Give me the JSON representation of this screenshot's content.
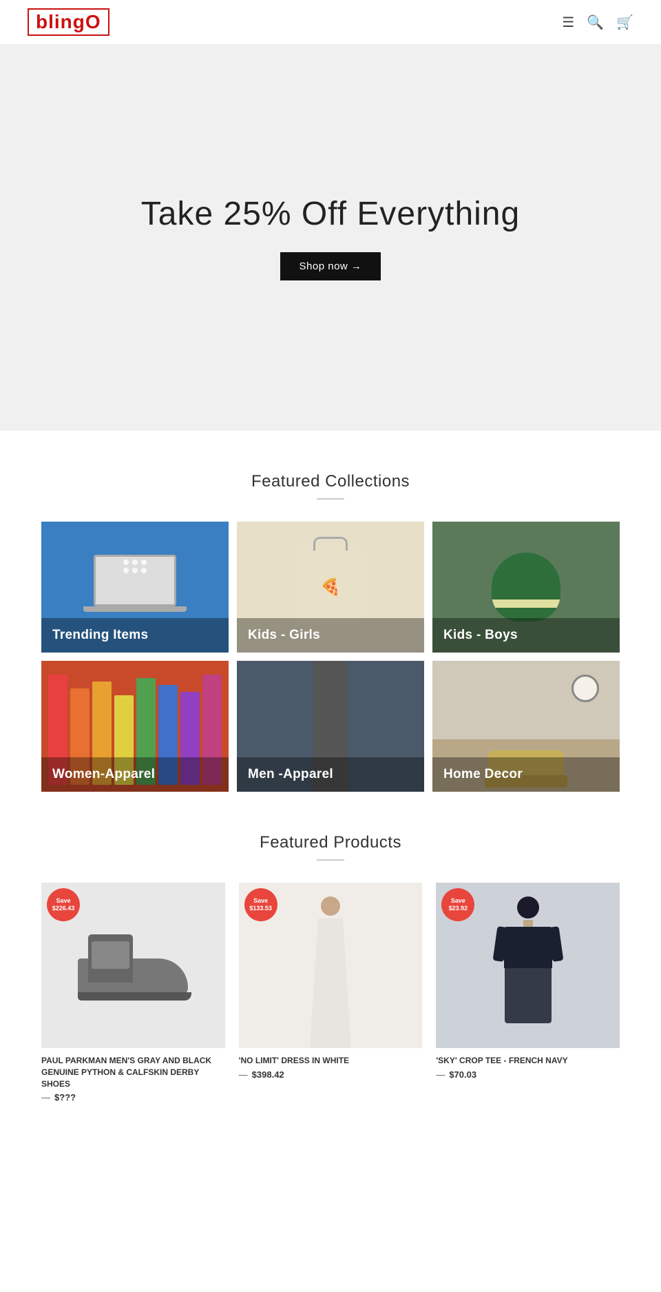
{
  "header": {
    "logo_text": "blingO",
    "logo_text_main": "bling",
    "logo_text_accent": "O"
  },
  "hero": {
    "title": "Take 25% Off Everything",
    "shop_now": "Shop now →"
  },
  "featured_collections": {
    "section_title": "Featured Collections",
    "items": [
      {
        "id": "trending",
        "label": "Trending Items"
      },
      {
        "id": "kids-girls",
        "label": "Kids - Girls"
      },
      {
        "id": "kids-boys",
        "label": "Kids - Boys"
      },
      {
        "id": "women",
        "label": "Women-Apparel"
      },
      {
        "id": "men",
        "label": "Men -Apparel"
      },
      {
        "id": "home-decor",
        "label": "Home Decor"
      }
    ]
  },
  "featured_products": {
    "section_title": "Featured Products",
    "items": [
      {
        "id": "shoe",
        "save_label": "Save",
        "save_amount": "$226.43",
        "name": "PAUL PARKMAN MEN'S GRAY AND BLACK GENUINE PYTHON & CALFSKIN DERBY SHOES",
        "price_prefix": "—",
        "price": "$???",
        "old_price": ""
      },
      {
        "id": "dress",
        "save_label": "Save",
        "save_amount": "$133.53",
        "name": "'No Limit' Dress in White",
        "price_prefix": "—",
        "price": "$398.42",
        "old_price": ""
      },
      {
        "id": "crop-tee",
        "save_label": "Save",
        "save_amount": "$23.92",
        "name": "'Sky' Crop Tee - French Navy",
        "price_prefix": "—",
        "price": "$70.03",
        "old_price": ""
      }
    ]
  }
}
